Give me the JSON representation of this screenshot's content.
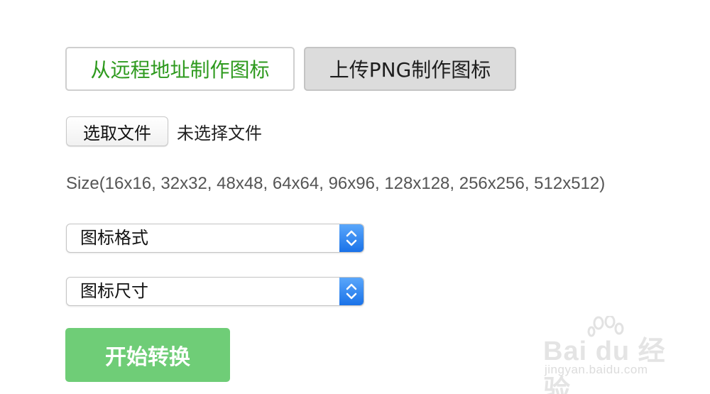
{
  "tabs": {
    "remote_label": "从远程地址制作图标",
    "upload_label": "上传PNG制作图标"
  },
  "file_picker": {
    "button_label": "选取文件",
    "status_text": "未选择文件"
  },
  "size_info": "Size(16x16, 32x32, 48x48, 64x64, 96x96, 128x128, 256x256, 512x512)",
  "selects": {
    "format_selected": "图标格式",
    "size_selected": "图标尺寸"
  },
  "start_button_label": "开始转换",
  "watermark": {
    "logo_text": "Bai du 经验",
    "url": "jingyan.baidu.com"
  },
  "colors": {
    "active_tab_text": "#2e9a1e",
    "start_button": "#6fcd77",
    "select_arrow": "#1a72e8"
  }
}
